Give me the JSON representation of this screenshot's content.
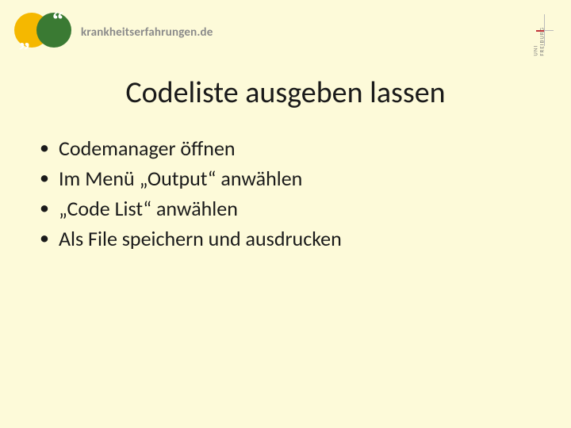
{
  "logo": {
    "brand_text": "krankheitserfahrungen.de",
    "open_quote": "„",
    "close_quote": "“"
  },
  "uni_logo": {
    "line1": "UNI",
    "line2": "FREIBURG"
  },
  "title": "Codeliste ausgeben lassen",
  "bullets": [
    "Codemanager öffnen",
    "Im Menü „Output“ anwählen",
    "„Code List“ anwählen",
    "Als File speichern und ausdrucken"
  ]
}
